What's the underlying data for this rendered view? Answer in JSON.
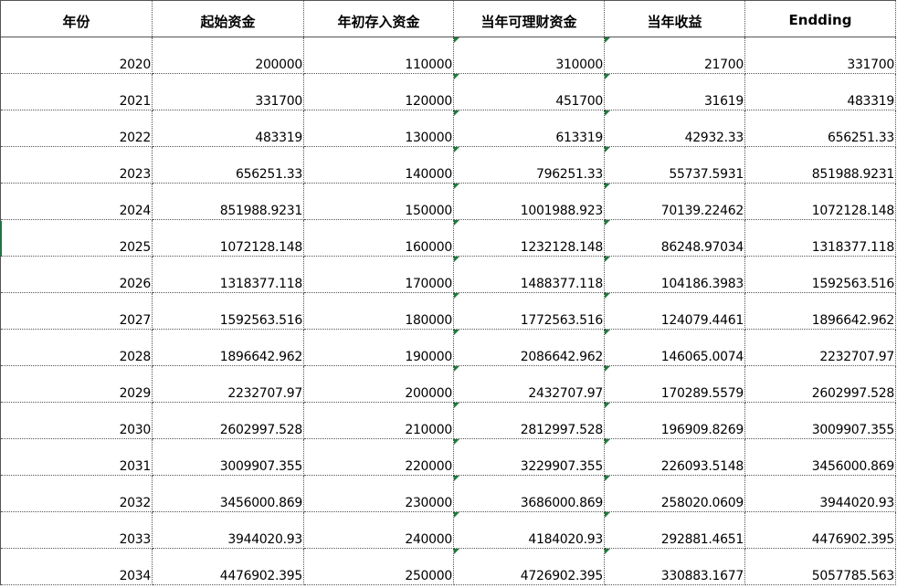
{
  "sheet": {
    "headers": [
      "年份",
      "起始资金",
      "年初存入资金",
      "当年可理财资金",
      "当年收益",
      "Endding"
    ],
    "rows": [
      [
        "2020",
        "200000",
        "110000",
        "310000",
        "21700",
        "331700"
      ],
      [
        "2021",
        "331700",
        "120000",
        "451700",
        "31619",
        "483319"
      ],
      [
        "2022",
        "483319",
        "130000",
        "613319",
        "42932.33",
        "656251.33"
      ],
      [
        "2023",
        "656251.33",
        "140000",
        "796251.33",
        "55737.5931",
        "851988.9231"
      ],
      [
        "2024",
        "851988.9231",
        "150000",
        "1001988.923",
        "70139.22462",
        "1072128.148"
      ],
      [
        "2025",
        "1072128.148",
        "160000",
        "1232128.148",
        "86248.97034",
        "1318377.118"
      ],
      [
        "2026",
        "1318377.118",
        "170000",
        "1488377.118",
        "104186.3983",
        "1592563.516"
      ],
      [
        "2027",
        "1592563.516",
        "180000",
        "1772563.516",
        "124079.4461",
        "1896642.962"
      ],
      [
        "2028",
        "1896642.962",
        "190000",
        "2086642.962",
        "146065.0074",
        "2232707.97"
      ],
      [
        "2029",
        "2232707.97",
        "200000",
        "2432707.97",
        "170289.5579",
        "2602997.528"
      ],
      [
        "2030",
        "2602997.528",
        "210000",
        "2812997.528",
        "196909.8269",
        "3009907.355"
      ],
      [
        "2031",
        "3009907.355",
        "220000",
        "3229907.355",
        "226093.5148",
        "3456000.869"
      ],
      [
        "2032",
        "3456000.869",
        "230000",
        "3686000.869",
        "258020.0609",
        "3944020.93"
      ],
      [
        "2033",
        "3944020.93",
        "240000",
        "4184020.93",
        "292881.4651",
        "4476902.395"
      ],
      [
        "2034",
        "4476902.395",
        "250000",
        "4726902.395",
        "330883.1677",
        "5057785.563"
      ]
    ]
  },
  "colors": {
    "grid_line": "#555555",
    "error_flag": "#1e7a3a",
    "selection": "#217346"
  }
}
